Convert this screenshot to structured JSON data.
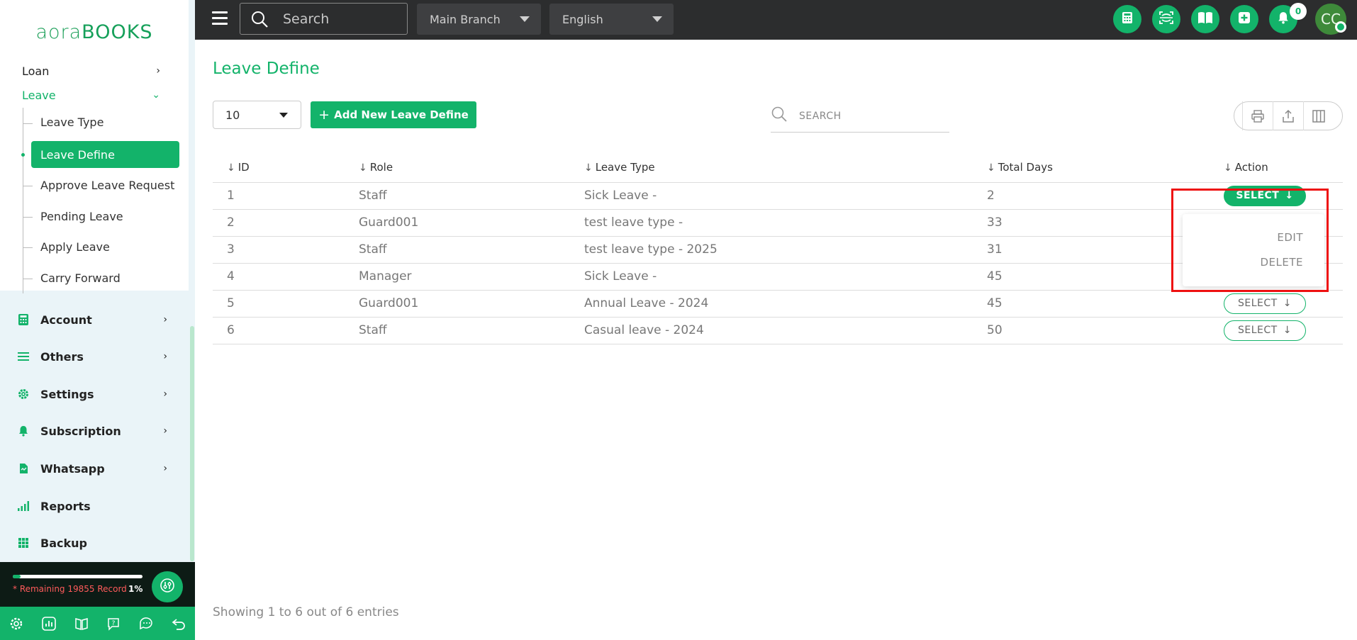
{
  "brand": {
    "logo_part1": "aora",
    "logo_part2": "BOOKS"
  },
  "topbar": {
    "search_placeholder": "Search",
    "branch": "Main Branch",
    "language": "English",
    "notification_count": "0",
    "avatar_initials": "CC"
  },
  "sidebar": {
    "loan": "Loan",
    "leave": "Leave",
    "leave_sub": [
      "Leave Type",
      "Leave Define",
      "Approve Leave Request",
      "Pending Leave",
      "Apply Leave",
      "Carry Forward"
    ],
    "main_items": [
      {
        "label": "Account",
        "icon": "calculator-icon"
      },
      {
        "label": "Others",
        "icon": "list-icon"
      },
      {
        "label": "Settings",
        "icon": "gear-icon"
      },
      {
        "label": "Subscription",
        "icon": "bell-icon"
      },
      {
        "label": "Whatsapp",
        "icon": "document-icon"
      },
      {
        "label": "Reports",
        "icon": "bar-chart-icon"
      },
      {
        "label": "Backup",
        "icon": "grid-icon"
      }
    ],
    "footer": {
      "remaining_text": "* Remaining 19855 Record",
      "percent_text": "1%",
      "progress_percent": 1
    }
  },
  "main": {
    "title": "Leave Define",
    "page_size": "10",
    "add_button": "Add New Leave Define",
    "table_search_placeholder": "SEARCH",
    "columns": [
      "ID",
      "Role",
      "Leave Type",
      "Total Days",
      "Action"
    ],
    "rows": [
      {
        "id": "1",
        "role": "Staff",
        "type": "Sick Leave -",
        "days": "2"
      },
      {
        "id": "2",
        "role": "Guard001",
        "type": "test leave type -",
        "days": "33"
      },
      {
        "id": "3",
        "role": "Staff",
        "type": "test leave type - 2025",
        "days": "31"
      },
      {
        "id": "4",
        "role": "Manager",
        "type": "Sick Leave -",
        "days": "45"
      },
      {
        "id": "5",
        "role": "Guard001",
        "type": "Annual Leave - 2024",
        "days": "45"
      },
      {
        "id": "6",
        "role": "Staff",
        "type": "Casual leave - 2024",
        "days": "50"
      }
    ],
    "select_label": "SELECT",
    "dropdown": {
      "edit": "EDIT",
      "delete": "DELETE"
    },
    "entries_info": "Showing 1 to 6 out of 6 entries"
  },
  "colors": {
    "accent": "#13b36a",
    "topbar": "#2c2d2e",
    "highlight": "#ee1111"
  }
}
